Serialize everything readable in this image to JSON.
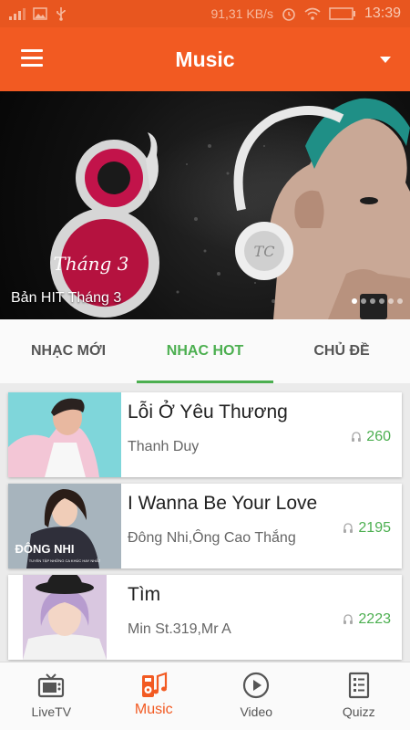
{
  "status_bar": {
    "speed": "91,31 KB/s",
    "time": "13:39"
  },
  "header": {
    "title": "Music",
    "menu_icon": "hamburger-menu-icon",
    "dropdown_icon": "caret-down-icon"
  },
  "banner": {
    "caption": "Bản HIT Tháng 3",
    "art_text": "Tháng 3",
    "art_number": "8",
    "headphone_logo": "TC",
    "slide_count": 6,
    "active_slide": 1
  },
  "tabs": [
    {
      "label": "NHẠC MỚI",
      "active": false
    },
    {
      "label": "NHẠC HOT",
      "active": true
    },
    {
      "label": "CHỦ ĐỀ",
      "active": false
    }
  ],
  "songs": [
    {
      "title": "Lỗi Ở Yêu Thương",
      "artist": "Thanh Duy",
      "plays": "260"
    },
    {
      "title": "I Wanna Be Your Love",
      "artist": "Đông Nhi,Ông Cao Thắng",
      "plays": "2195",
      "cover_text": "ĐÔNG NHI",
      "cover_subtext": "TUYỂN TẬP NHỮNG CA KHÚC HAY NHẤT"
    },
    {
      "title": "Tìm",
      "artist": "Min St.319,Mr A",
      "plays": "2223"
    }
  ],
  "bottom_nav": [
    {
      "label": "LiveTV",
      "icon": "tv-icon",
      "active": false
    },
    {
      "label": "Music",
      "icon": "music-device-icon",
      "active": true
    },
    {
      "label": "Video",
      "icon": "play-circle-icon",
      "active": false
    },
    {
      "label": "Quizz",
      "icon": "quiz-list-icon",
      "active": false
    }
  ],
  "colors": {
    "primary": "#f25a22",
    "status_bar": "#e8561f",
    "accent": "#4caf50",
    "background": "#ebebeb"
  }
}
